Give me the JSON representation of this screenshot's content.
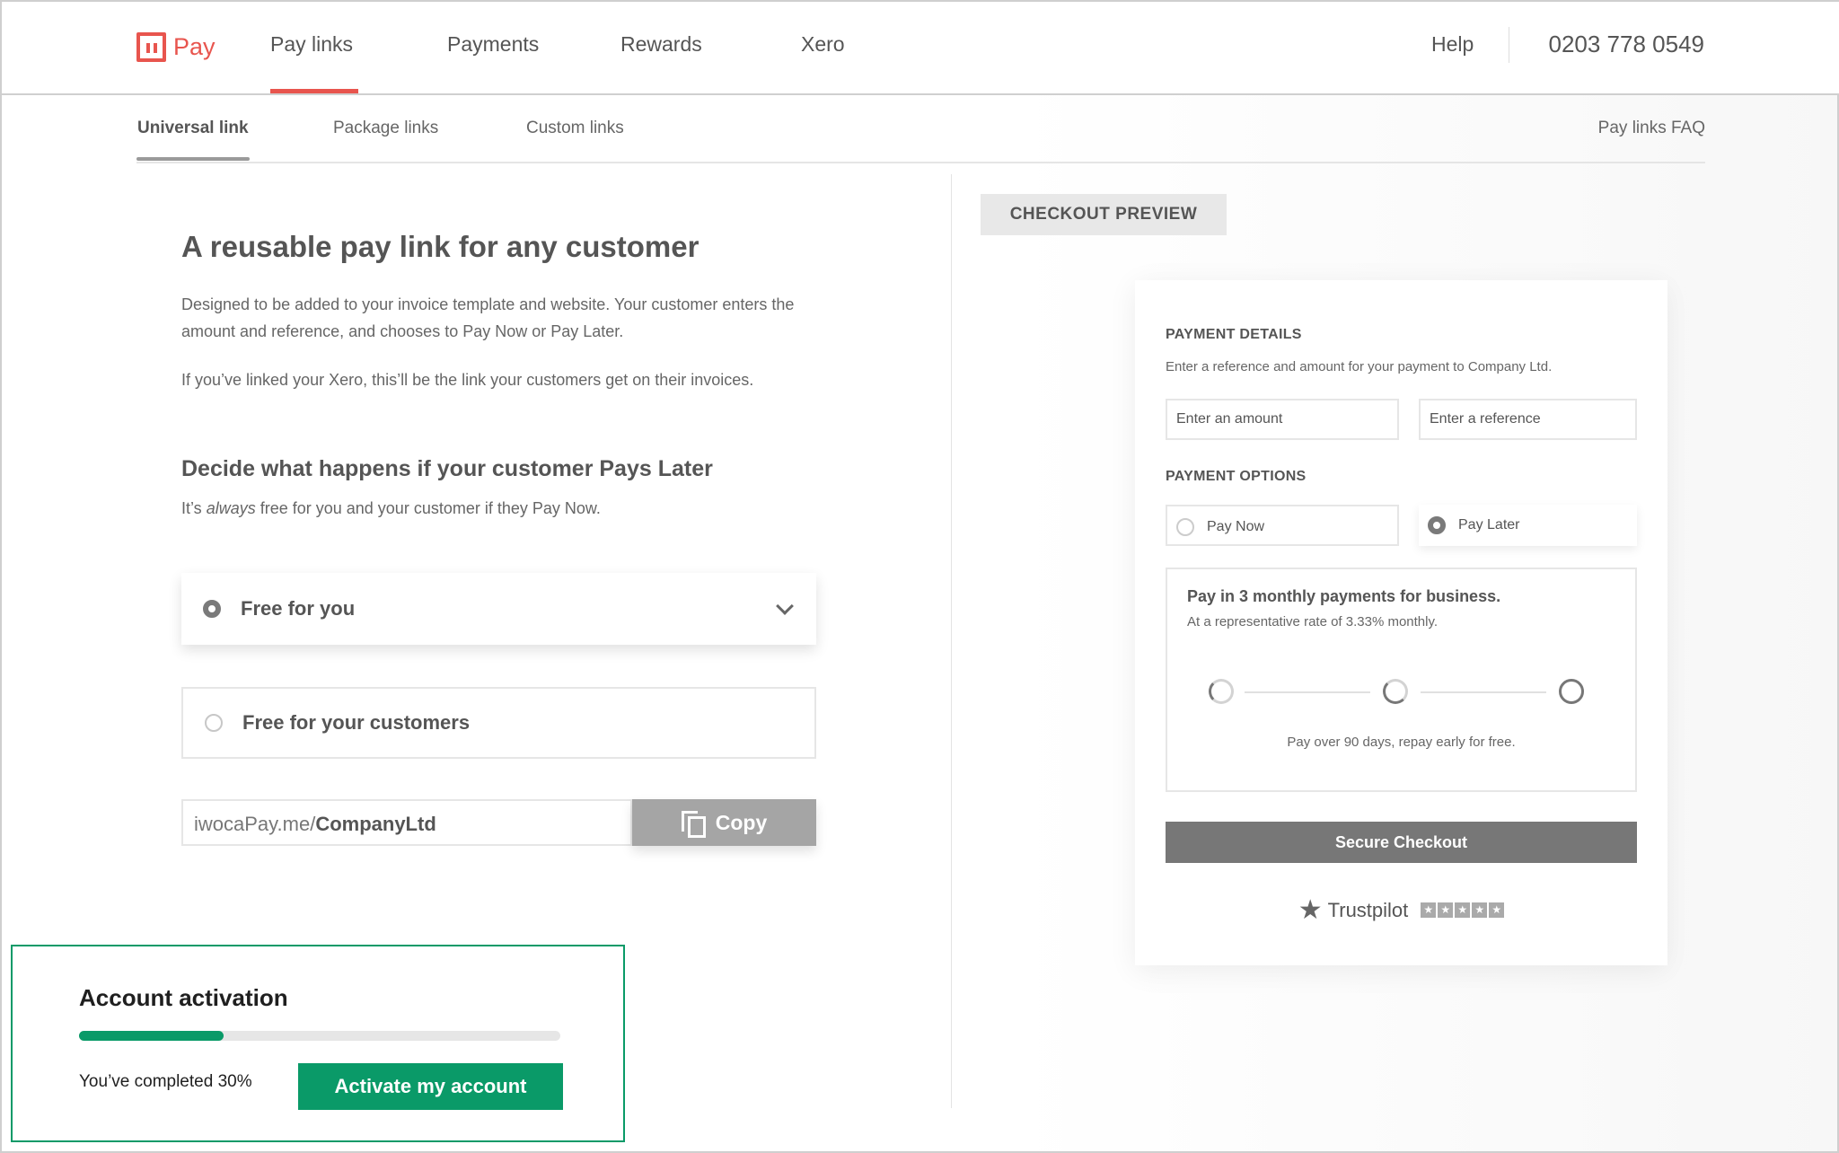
{
  "brand": {
    "name": "Pay"
  },
  "topnav": {
    "items": [
      "Pay links",
      "Payments",
      "Rewards",
      "Xero"
    ],
    "help": "Help",
    "phone": "0203 778 0549"
  },
  "subnav": {
    "items": [
      "Universal link",
      "Package links",
      "Custom links"
    ],
    "faq": "Pay links FAQ"
  },
  "main": {
    "title": "A reusable pay link for any customer",
    "description": "Designed to be added to your invoice template and website.  Your customer enters the amount and reference, and chooses to Pay Now or Pay Later.",
    "xero_note": "If you’ve linked your Xero, this’ll be the link your customers get on their invoices.",
    "section_title": "Decide what happens if your customer Pays Later",
    "section_note_pre": "It’s ",
    "section_note_em": "always",
    "section_note_post": " free for you and your customer if they Pay Now.",
    "options": [
      "Free for you",
      "Free for your customers"
    ],
    "link_prefix": "iwocaPay.me/",
    "link_slug": "CompanyLtd",
    "copy_label": "Copy"
  },
  "activation": {
    "title": "Account activation",
    "progress_percent": 30,
    "status": "You’ve completed 30%",
    "button": "Activate my account"
  },
  "preview": {
    "tag": "CHECKOUT PREVIEW",
    "payment_details_label": "PAYMENT DETAILS",
    "payment_details_text": "Enter a reference and amount for your payment to Company Ltd.",
    "amount_placeholder": "Enter an amount",
    "reference_placeholder": "Enter a reference",
    "payment_options_label": "PAYMENT OPTIONS",
    "pay_now": "Pay Now",
    "pay_later": "Pay Later",
    "plan_title": "Pay in 3 monthly payments for business.",
    "plan_sub": "At a representative rate of 3.33% monthly.",
    "plan_foot": "Pay over 90 days, repay early for free.",
    "checkout": "Secure Checkout",
    "trustpilot": "Trustpilot"
  },
  "colors": {
    "accent": "#e8554e",
    "green": "#0a9a68"
  }
}
